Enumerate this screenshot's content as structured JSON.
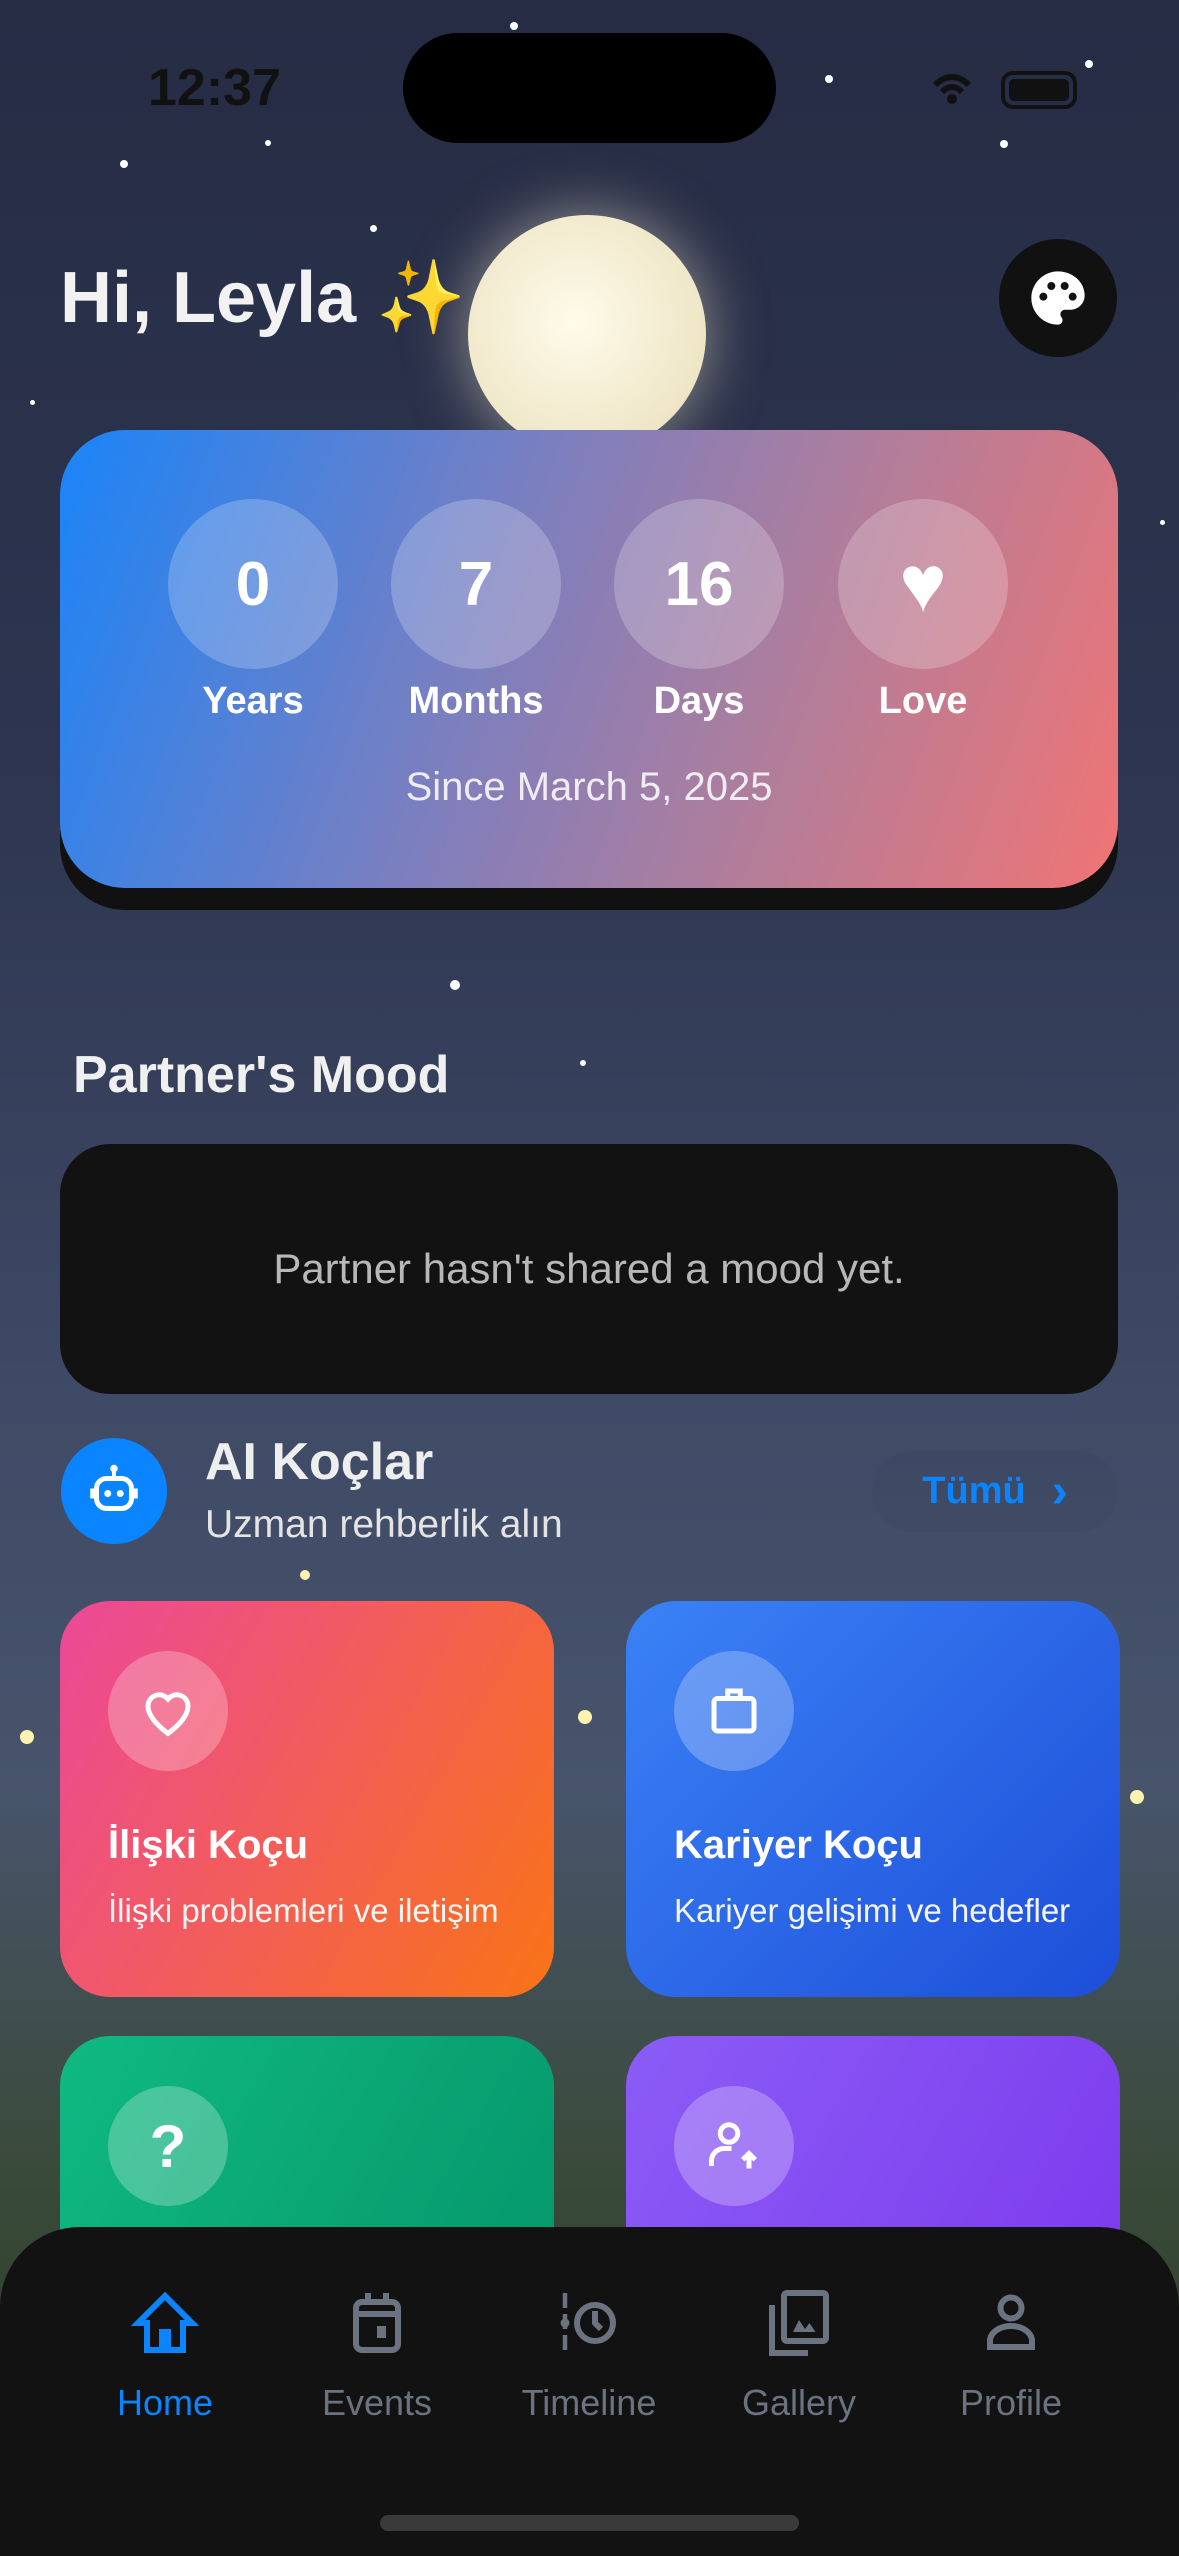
{
  "status_bar": {
    "time": "12:37"
  },
  "header": {
    "greeting": "Hi, Leyla",
    "sparkle": "✨",
    "theme_button_icon": "palette-icon"
  },
  "counter": {
    "items": [
      {
        "value": "0",
        "label": "Years"
      },
      {
        "value": "7",
        "label": "Months"
      },
      {
        "value": "16",
        "label": "Days"
      },
      {
        "value": "♥",
        "label": "Love"
      }
    ],
    "since": "Since March 5, 2025"
  },
  "mood": {
    "title": "Partner's Mood",
    "empty_text": "Partner hasn't shared a mood yet."
  },
  "ai": {
    "title": "AI Koçlar",
    "subtitle": "Uzman rehberlik alın",
    "see_all": "Tümü",
    "chevron": "›"
  },
  "coaches": [
    {
      "title": "İlişki Koçu",
      "subtitle": "İlişki problemleri ve iletişim",
      "icon": "heart-icon",
      "color": "#f05a6a"
    },
    {
      "title": "Kariyer Koçu",
      "subtitle": "Kariyer gelişimi ve hedefler",
      "icon": "briefcase-icon",
      "color": "#2d6ee8"
    },
    {
      "title": "",
      "subtitle": "",
      "icon": "question-icon",
      "color": "#10a874"
    },
    {
      "title": "",
      "subtitle": "",
      "icon": "person-upload-icon",
      "color": "#7c4ef0"
    }
  ],
  "tabs": [
    {
      "label": "Home",
      "active": true
    },
    {
      "label": "Events"
    },
    {
      "label": "Timeline"
    },
    {
      "label": "Gallery"
    },
    {
      "label": "Profile"
    }
  ]
}
